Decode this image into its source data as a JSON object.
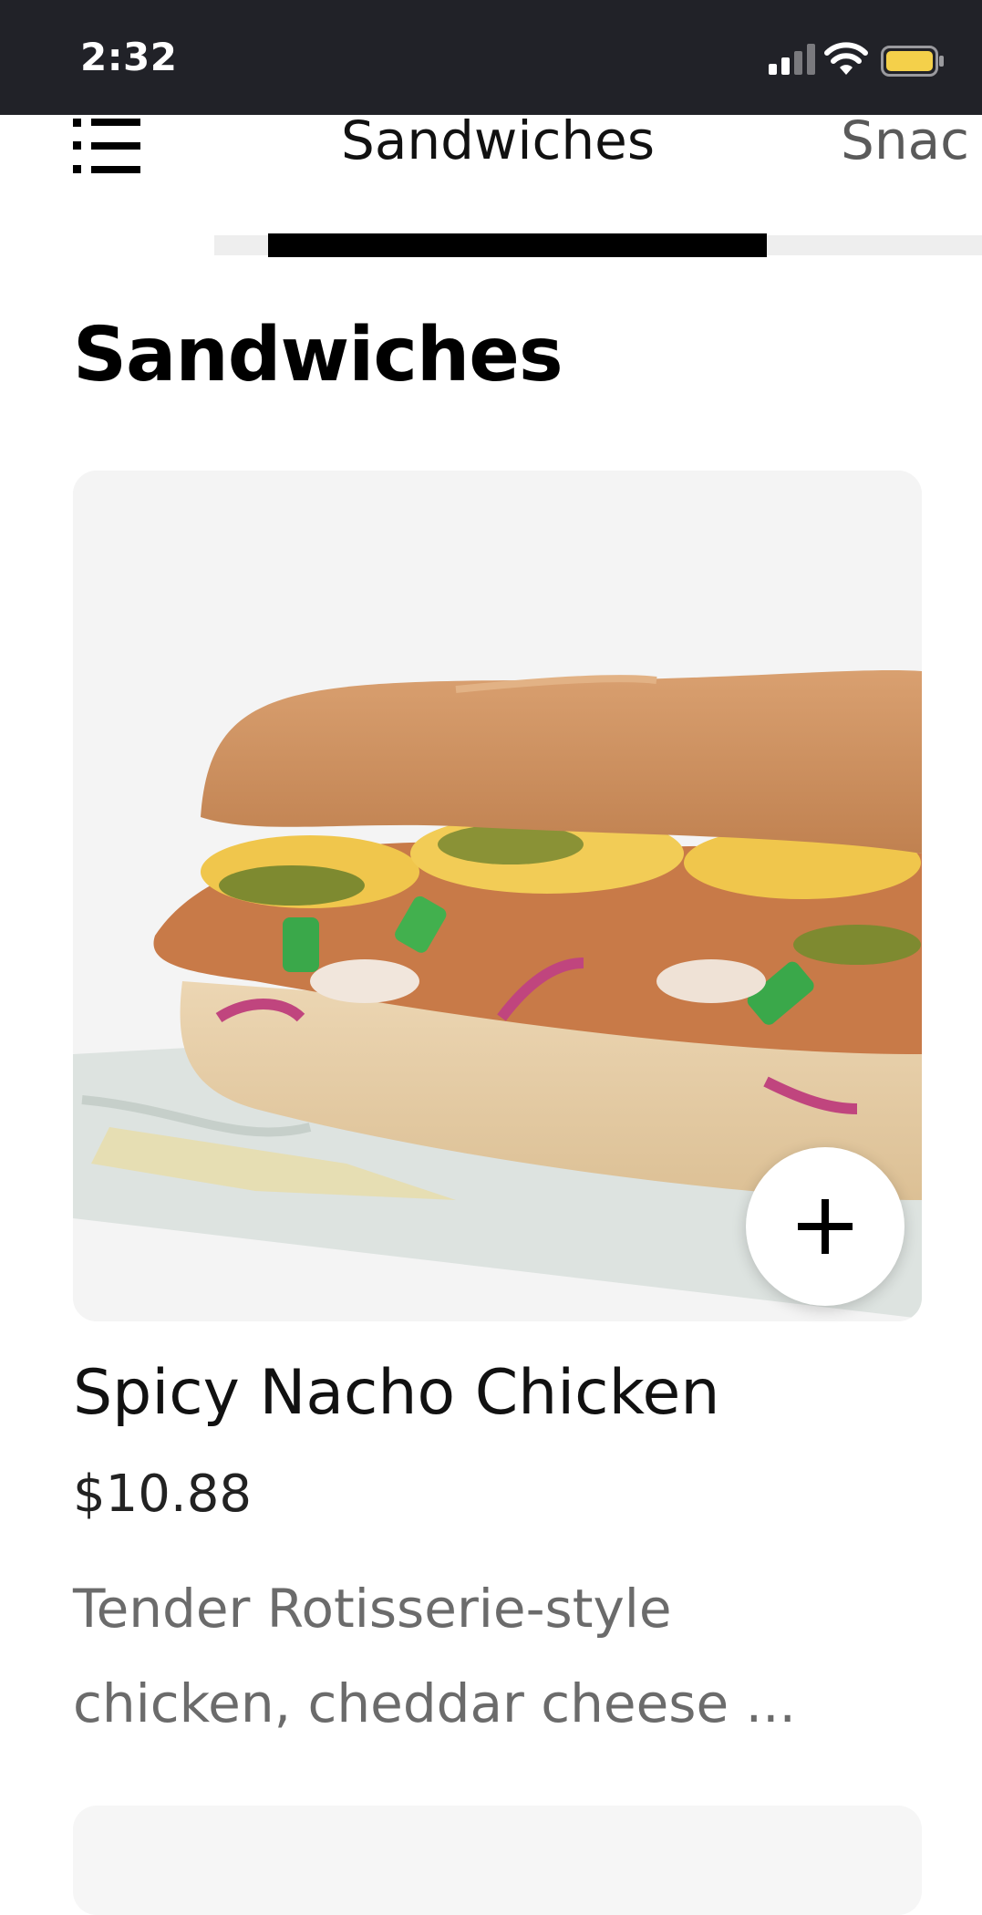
{
  "status_bar": {
    "time": "2:32",
    "icons": [
      "cellular-signal-icon",
      "wifi-icon",
      "battery-icon"
    ],
    "battery_color": "#f4d04a"
  },
  "category_nav": {
    "menu_icon": "list-menu-icon",
    "tabs": [
      {
        "label": "Sandwiches",
        "active": true
      },
      {
        "label": "Snac",
        "active": false
      }
    ]
  },
  "section": {
    "title": "Sandwiches"
  },
  "product": {
    "image": "sandwich-image",
    "add_icon": "plus-icon",
    "name": "Spicy Nacho Chicken",
    "price": "$10.88",
    "description": "Tender Rotisserie-style chicken, cheddar cheese ..."
  },
  "colors": {
    "status_bar_bg": "#212228",
    "accent": "#000000",
    "text_primary": "#111111",
    "text_secondary": "#6b6b6b"
  }
}
